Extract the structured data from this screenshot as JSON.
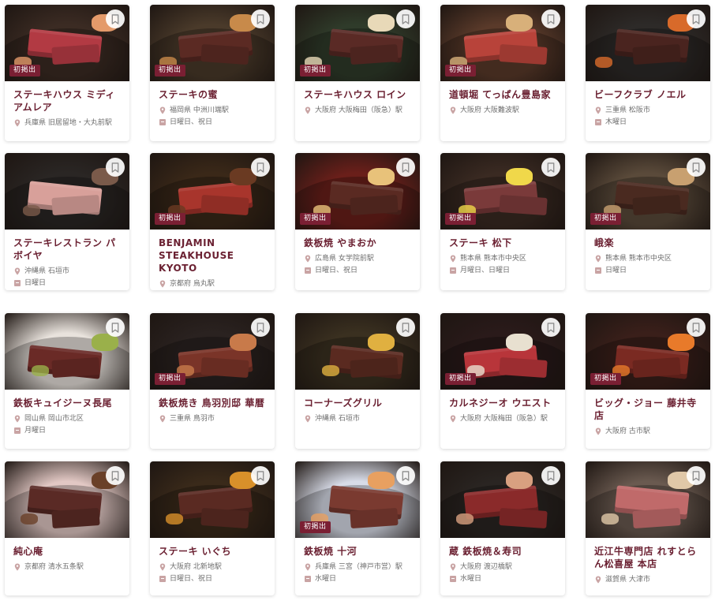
{
  "badge_label": "初掲出",
  "colors": {
    "title": "#6b2132",
    "badge": "#7a1f33",
    "meta": "#6e6e6e"
  },
  "rows": [
    {
      "cards": [
        {
          "name": "ステーキハウス ミディアムレア",
          "location": "兵庫県 旧居留地・大丸前駅",
          "closed": "",
          "new": true
        },
        {
          "name": "ステーキの蜜",
          "location": "福岡県 中洲川端駅",
          "closed": "日曜日、祝日",
          "new": true
        },
        {
          "name": "ステーキハウス ロイン",
          "location": "大阪府 大阪梅田（阪急）駅",
          "closed": "",
          "new": true
        },
        {
          "name": "道頓堀 てっぱん豊島家",
          "location": "大阪府 大阪難波駅",
          "closed": "",
          "new": true
        },
        {
          "name": "ビーフクラブ ノエル",
          "location": "三重県 松阪市",
          "closed": "木曜日",
          "new": false
        }
      ]
    },
    {
      "cards": [
        {
          "name": "ステーキレストラン パボイヤ",
          "location": "沖縄県 石垣市",
          "closed": "日曜日",
          "new": false
        },
        {
          "name": "BENJAMIN STEAKHOUSE KYOTO",
          "location": "京都府 烏丸駅",
          "closed": "",
          "new": true
        },
        {
          "name": "鉄板焼 やまおか",
          "location": "広島県 女学院前駅",
          "closed": "日曜日、祝日",
          "new": true
        },
        {
          "name": "ステーキ 松下",
          "location": "熊本県 熊本市中央区",
          "closed": "月曜日、日曜日",
          "new": true
        },
        {
          "name": "峨楽",
          "location": "熊本県 熊本市中央区",
          "closed": "日曜日",
          "new": true
        }
      ]
    },
    {
      "cards": [
        {
          "name": "鉄板キュイジーヌ長尾",
          "location": "岡山県 岡山市北区",
          "closed": "月曜日",
          "new": false
        },
        {
          "name": "鉄板焼き 鳥羽別邸 華暦",
          "location": "三重県 鳥羽市",
          "closed": "",
          "new": true
        },
        {
          "name": "コーナーズグリル",
          "location": "沖縄県 石垣市",
          "closed": "",
          "new": false
        },
        {
          "name": "カルネジーオ ウエスト",
          "location": "大阪府 大阪梅田（阪急）駅",
          "closed": "",
          "new": true
        },
        {
          "name": "ビッグ・ジョー 藤井寺店",
          "location": "大阪府 古市駅",
          "closed": "",
          "new": true
        }
      ]
    },
    {
      "cards": [
        {
          "name": "純心庵",
          "location": "京都府 清水五条駅",
          "closed": "",
          "new": false
        },
        {
          "name": "ステーキ いぐち",
          "location": "大阪府 北新地駅",
          "closed": "日曜日、祝日",
          "new": false
        },
        {
          "name": "鉄板焼 十河",
          "location": "兵庫県 三宮（神戸市営）駅",
          "closed": "水曜日",
          "new": true
        },
        {
          "name": "蔵 鉄板焼＆寿司",
          "location": "大阪府 渡辺橋駅",
          "closed": "水曜日",
          "new": false
        },
        {
          "name": "近江牛専門店 れすとらん松喜屋 本店",
          "location": "滋賀県 大津市",
          "closed": "",
          "new": false
        }
      ]
    }
  ]
}
